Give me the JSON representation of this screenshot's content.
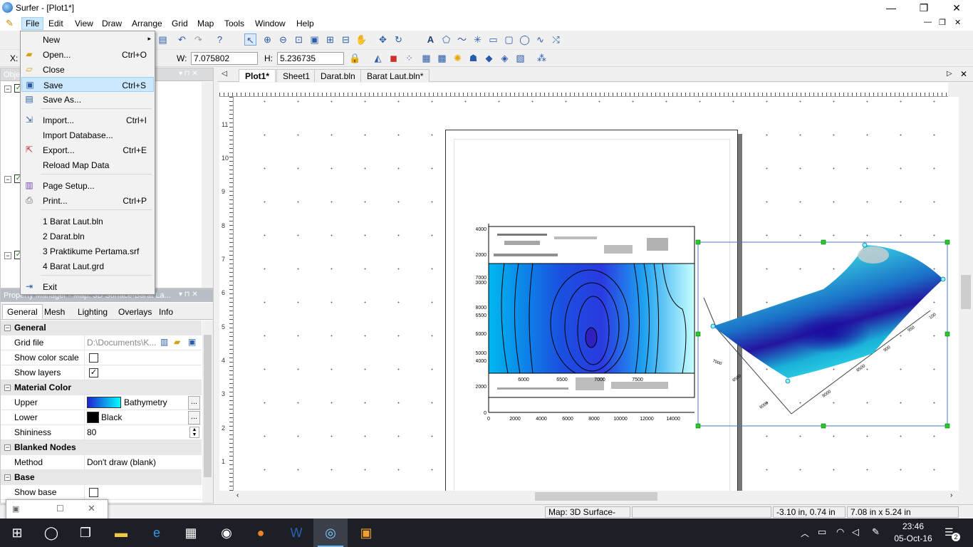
{
  "window": {
    "title": "Surfer - [Plot1*]",
    "minimize": "—",
    "maximize": "❐",
    "close": "✕"
  },
  "menubar": [
    "File",
    "Edit",
    "View",
    "Draw",
    "Arrange",
    "Grid",
    "Map",
    "Tools",
    "Window",
    "Help"
  ],
  "mdi_controls": {
    "min": "—",
    "restore": "❐",
    "close": "✕"
  },
  "toolbar2": {
    "x_label": "X:",
    "w_label": "W:",
    "w_value": "7.075802",
    "h_label": "H:",
    "h_value": "5.236735"
  },
  "file_menu": [
    {
      "label": "New",
      "shortcut": "",
      "icon": "new-icon",
      "arrow": "▸"
    },
    {
      "label": "Open...",
      "shortcut": "Ctrl+O",
      "icon": "open-folder-icon"
    },
    {
      "label": "Close",
      "shortcut": "",
      "icon": "close-folder-icon"
    },
    {
      "label": "Save",
      "shortcut": "Ctrl+S",
      "icon": "save-icon"
    },
    {
      "label": "Save As...",
      "shortcut": "",
      "icon": "save-as-icon"
    },
    {
      "label": "Import...",
      "shortcut": "Ctrl+I",
      "icon": "import-icon"
    },
    {
      "label": "Import Database...",
      "shortcut": "",
      "icon": ""
    },
    {
      "label": "Export...",
      "shortcut": "Ctrl+E",
      "icon": "export-icon"
    },
    {
      "label": "Reload Map Data",
      "shortcut": "",
      "icon": ""
    },
    {
      "label": "Page Setup...",
      "shortcut": "",
      "icon": "page-setup-icon"
    },
    {
      "label": "Print...",
      "shortcut": "Ctrl+P",
      "icon": "print-icon"
    },
    {
      "label": "1 Barat Laut.bln",
      "shortcut": "",
      "icon": ""
    },
    {
      "label": "2 Darat.bln",
      "shortcut": "",
      "icon": ""
    },
    {
      "label": "3 Praktikume Pertama.srf",
      "shortcut": "",
      "icon": ""
    },
    {
      "label": "4 Barat Laut.grd",
      "shortcut": "",
      "icon": ""
    },
    {
      "label": "Exit",
      "shortcut": "",
      "icon": "exit-icon"
    }
  ],
  "object_panel": {
    "title": "Obje"
  },
  "property_panel": {
    "title": "Property Manager - Map: 3D Surface-Barat La...",
    "tabs": [
      "General",
      "Mesh",
      "Lighting",
      "Overlays",
      "Info"
    ],
    "groups": {
      "general": "General",
      "material": "Material Color",
      "blanked": "Blanked Nodes",
      "base": "Base"
    },
    "rows": {
      "grid_file_label": "Grid file",
      "grid_file_value": "D:\\Documents\\K...",
      "show_color_scale_label": "Show color scale",
      "show_layers_label": "Show layers",
      "upper_label": "Upper",
      "upper_value": "Bathymetry",
      "lower_label": "Lower",
      "lower_value": "Black",
      "shininess_label": "Shininess",
      "shininess_value": "80",
      "method_label": "Method",
      "method_value": "Don't draw (blank)",
      "show_base_label": "Show base",
      "ellipsis": "..."
    }
  },
  "doc_tabs": [
    "Plot1*",
    "Sheet1",
    "Darat.bln",
    "Barat Laut.bln*"
  ],
  "ruler_v": [
    "11",
    "10",
    "9",
    "8",
    "7",
    "6",
    "5",
    "4",
    "3",
    "2",
    "1"
  ],
  "contour_axes": {
    "y_upper": [
      "14000",
      "12000"
    ],
    "y_mid": [
      "7000",
      "10000",
      "8000",
      "6500",
      "6000",
      "5000",
      "4000"
    ],
    "y_lower": [
      "2000",
      "0"
    ],
    "x_lower": [
      "0",
      "2000",
      "4000",
      "6000",
      "8000",
      "10000",
      "12000",
      "14000"
    ],
    "x_inner": [
      "6000",
      "6500",
      "7000",
      "7500"
    ]
  },
  "surface_labels": [
    "7000",
    "6500",
    "6000",
    "8000",
    "8500",
    "900",
    "950",
    "100"
  ],
  "statusbar": {
    "selection": "Map: 3D Surface-Bar...",
    "cursor": "-3.10 in, 0.74 in",
    "size": "7.08 in x 5.24 in"
  },
  "taskbar": {
    "time": "23:46",
    "date": "05-Oct-16",
    "notifications": "2"
  },
  "colors": {
    "accent": "#0078d7",
    "menu_highlight": "#cce8ff",
    "taskbar": "#1c1f26"
  }
}
